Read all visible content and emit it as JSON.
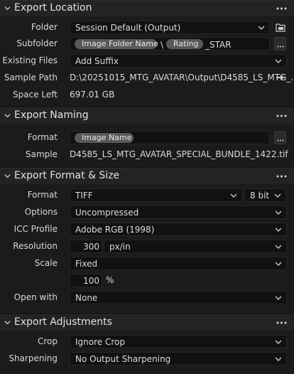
{
  "export_location": {
    "title": "Export Location",
    "folder": {
      "label": "Folder",
      "value": "Session Default (Output)"
    },
    "subfolder": {
      "label": "Subfolder",
      "token1": "Image Folder Name",
      "separator": "\\",
      "token2": "Rating",
      "suffix": "_STAR"
    },
    "existing_files": {
      "label": "Existing Files",
      "value": "Add Suffix"
    },
    "sample_path": {
      "label": "Sample Path",
      "value": "D:\\20251015_MTG_AVATAR\\Output\\D4585_LS_MTG_..."
    },
    "space_left": {
      "label": "Space Left",
      "value": "697.01 GB"
    }
  },
  "export_naming": {
    "title": "Export Naming",
    "format": {
      "label": "Format",
      "token": "Image Name"
    },
    "sample": {
      "label": "Sample",
      "value": "D4585_LS_MTG_AVATAR_SPECIAL_BUNDLE_1422.tif"
    }
  },
  "export_format": {
    "title": "Export Format & Size",
    "format": {
      "label": "Format",
      "value": "TIFF",
      "bit_depth": "8 bit"
    },
    "options": {
      "label": "Options",
      "value": "Uncompressed"
    },
    "icc_profile": {
      "label": "ICC Profile",
      "value": "Adobe RGB (1998)"
    },
    "resolution": {
      "label": "Resolution",
      "value": "300",
      "unit": "px/in"
    },
    "scale": {
      "label": "Scale",
      "value": "Fixed",
      "percent": "100",
      "percent_unit": "%"
    },
    "open_with": {
      "label": "Open with",
      "value": "None"
    }
  },
  "export_adjustments": {
    "title": "Export Adjustments",
    "crop": {
      "label": "Crop",
      "value": "Ignore Crop"
    },
    "sharpening": {
      "label": "Sharpening",
      "value": "No Output Sharpening"
    }
  },
  "icons": {
    "collapse": "chevron-down-icon",
    "more": "more-dots-icon",
    "dropdown": "caret-down-icon",
    "folder": "folder-icon",
    "arrow": "arrow-right-icon"
  }
}
